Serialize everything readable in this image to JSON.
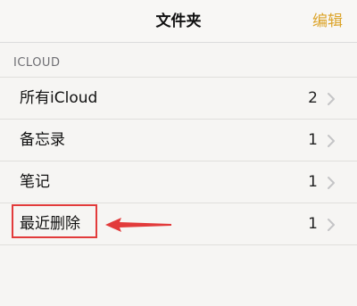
{
  "nav": {
    "title": "文件夹",
    "edit_label": "编辑"
  },
  "section": {
    "header": "ICLOUD"
  },
  "folders": [
    {
      "label": "所有iCloud",
      "count": "2"
    },
    {
      "label": "备忘录",
      "count": "1"
    },
    {
      "label": "笔记",
      "count": "1"
    },
    {
      "label": "最近删除",
      "count": "1"
    }
  ],
  "colors": {
    "accent": "#dca42a",
    "annotation": "#e23b3b",
    "background": "#f6f5f3"
  },
  "icons": {
    "row_chevron": "chevron-right-icon",
    "annotation_arrow": "arrow-left-icon"
  }
}
